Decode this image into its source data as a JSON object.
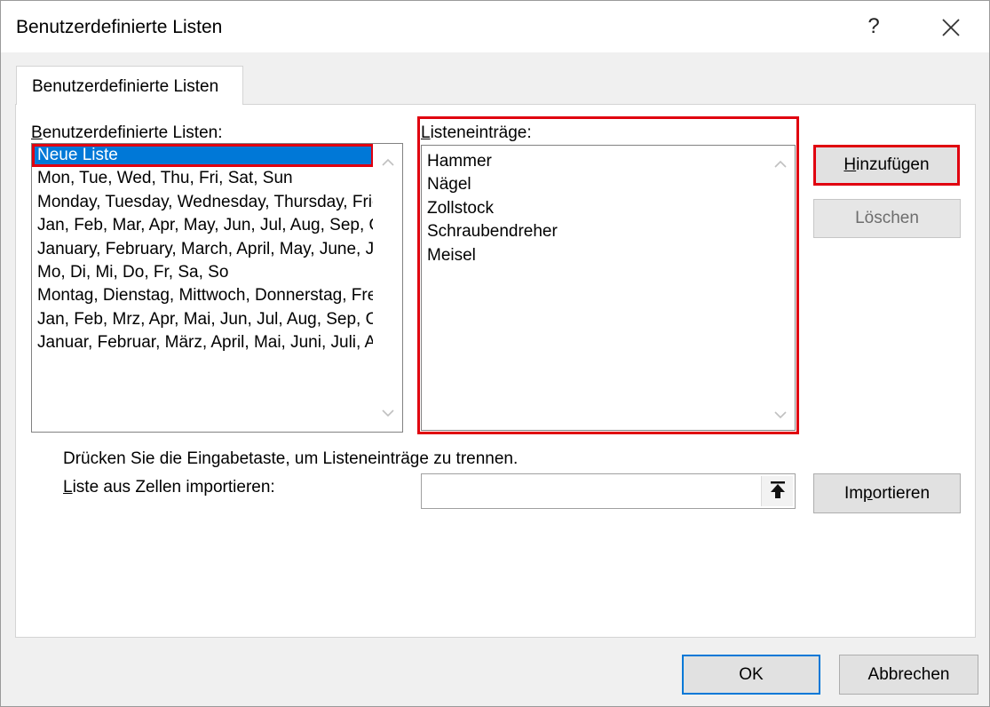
{
  "window": {
    "title": "Benutzerdefinierte Listen",
    "help_glyph": "?",
    "close_glyph": "close"
  },
  "tab": {
    "label": "Benutzerdefinierte Listen"
  },
  "lists_section": {
    "label_first": "B",
    "label_rest": "enutzerdefinierte Listen:",
    "items": [
      "Neue Liste",
      "Mon, Tue, Wed, Thu, Fri, Sat, Sun",
      "Monday, Tuesday, Wednesday, Thursday, Friday, Saturday, Sunday",
      "Jan, Feb, Mar, Apr, May, Jun, Jul, Aug, Sep, Oct, Nov, Dec",
      "January, February, March, April, May, June, July, August, September, October, November, December",
      "Mo, Di, Mi, Do, Fr, Sa, So",
      "Montag, Dienstag, Mittwoch, Donnerstag, Freitag, Samstag, Sonntag",
      "Jan, Feb, Mrz, Apr, Mai, Jun, Jul, Aug, Sep, Okt, Nov, Dez",
      "Januar, Februar, März, April, Mai, Juni, Juli, August, September, Oktober, November, Dezember"
    ],
    "selected_index": 0
  },
  "entries_section": {
    "label_first": "L",
    "label_rest": "isteneinträge:",
    "value": "Hammer\nNägel\nZollstock\nSchraubendreher\nMeisel"
  },
  "buttons": {
    "add_first": "H",
    "add_rest": "inzufügen",
    "delete": "Löschen",
    "import_pre": "Im",
    "import_u": "p",
    "import_rest": "ortieren",
    "ok": "OK",
    "cancel": "Abbrechen"
  },
  "hint": "Drücken Sie die Eingabetaste, um Listeneinträge zu trennen.",
  "import": {
    "label_first": "L",
    "label_rest": "iste aus Zellen importieren:",
    "value": ""
  },
  "colors": {
    "highlight": "#e0000f",
    "selection": "#0078d7"
  }
}
